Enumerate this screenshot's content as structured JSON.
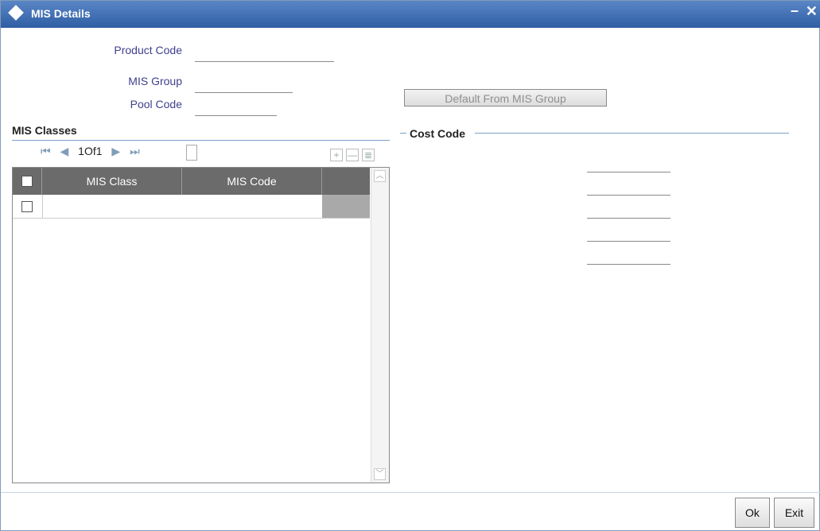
{
  "window": {
    "title": "MIS Details",
    "minimize_glyph": "–",
    "close_glyph": "✕"
  },
  "form": {
    "product_code_label": "Product Code",
    "product_code_value": "",
    "mis_group_label": "MIS Group",
    "mis_group_value": "",
    "pool_code_label": "Pool Code",
    "pool_code_value": "",
    "default_button": "Default From MIS Group"
  },
  "mis_classes": {
    "title": "MIS Classes",
    "pager": {
      "first": "⏮",
      "prev": "◀",
      "count": "1Of1",
      "next": "▶",
      "last": "⏭"
    },
    "tools": {
      "add": "+",
      "delete": "—",
      "view": "≣"
    },
    "columns": [
      "MIS Class",
      "MIS Code"
    ],
    "rows": [
      {
        "mis_class": "",
        "mis_code": ""
      }
    ]
  },
  "cost_code": {
    "title": "Cost Code",
    "values": [
      "",
      "",
      "",
      "",
      ""
    ]
  },
  "footer": {
    "ok": "Ok",
    "exit": "Exit"
  },
  "colors": {
    "titlebar": "#3a6bb0",
    "label": "#3f3f8f",
    "grid_header": "#6b6b6b"
  }
}
